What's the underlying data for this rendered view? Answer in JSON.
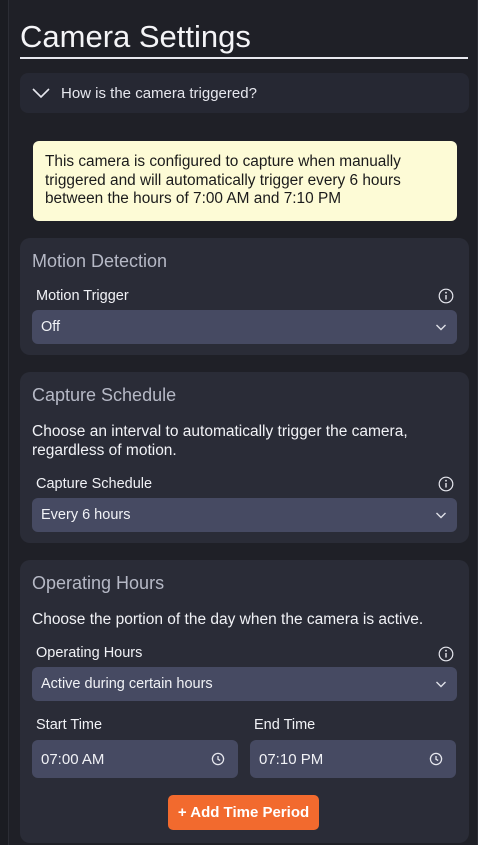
{
  "page": {
    "title": "Camera Settings"
  },
  "accordion": {
    "label": "How is the camera triggered?",
    "icon": "chevron-down-icon"
  },
  "note": {
    "text": "This camera is configured to capture when manually triggered and will automatically trigger every 6 hours between the hours of 7:00 AM and 7:10 PM",
    "background": "#fdfbd6"
  },
  "motion_detection": {
    "title": "Motion Detection",
    "field_label": "Motion Trigger",
    "value": "Off"
  },
  "capture_schedule": {
    "title": "Capture Schedule",
    "description": "Choose an interval to automatically trigger the camera, regardless of motion.",
    "field_label": "Capture Schedule",
    "value": "Every 6 hours"
  },
  "operating_hours": {
    "title": "Operating Hours",
    "description": "Choose the portion of the day when the camera is active.",
    "field_label": "Operating Hours",
    "value": "Active during certain hours",
    "start_label": "Start Time",
    "start_value": "07:00 AM",
    "end_label": "End Time",
    "end_value": "07:10 PM",
    "add_button": "+ Add Time Period"
  },
  "colors": {
    "accent": "#f26a2e",
    "card": "#2a2c37",
    "input": "#464a62"
  }
}
